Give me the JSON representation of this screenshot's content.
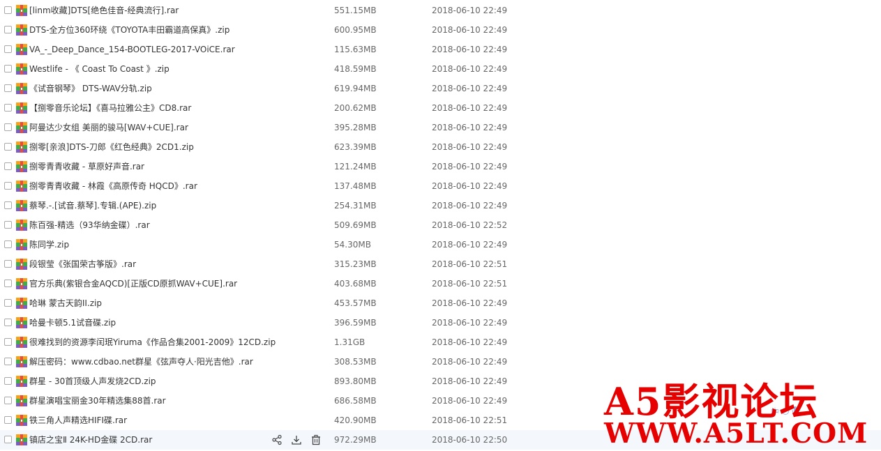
{
  "files": [
    {
      "name": "[linm收藏]DTS[绝色佳音-经典流行].rar",
      "size": "551.15MB",
      "date": "2018-06-10 22:49"
    },
    {
      "name": "DTS-全方位360环绕《TOYOTA丰田霸道高保真》.zip",
      "size": "600.95MB",
      "date": "2018-06-10 22:49"
    },
    {
      "name": "VA_-_Deep_Dance_154-BOOTLEG-2017-VOiCE.rar",
      "size": "115.63MB",
      "date": "2018-06-10 22:49"
    },
    {
      "name": "Westlife - 《 Coast To Coast 》.zip",
      "size": "418.59MB",
      "date": "2018-06-10 22:49"
    },
    {
      "name": "《试音钢琴》 DTS-WAV分轨.zip",
      "size": "619.94MB",
      "date": "2018-06-10 22:49"
    },
    {
      "name": "【捌零音乐论坛】《喜马拉雅公主》CD8.rar",
      "size": "200.62MB",
      "date": "2018-06-10 22:49"
    },
    {
      "name": "阿曼达少女组 美丽的骏马[WAV+CUE].rar",
      "size": "395.28MB",
      "date": "2018-06-10 22:49"
    },
    {
      "name": "捌零[亲浪]DTS-刀郎《红色经典》2CD1.zip",
      "size": "623.39MB",
      "date": "2018-06-10 22:49"
    },
    {
      "name": "捌零青青收藏 - 草原好声音.rar",
      "size": "121.24MB",
      "date": "2018-06-10 22:49"
    },
    {
      "name": "捌零青青收藏 - 林霞《高原传奇 HQCD》.rar",
      "size": "137.48MB",
      "date": "2018-06-10 22:49"
    },
    {
      "name": "蔡琴.-.[试音.蔡琴].专辑.(APE).zip",
      "size": "254.31MB",
      "date": "2018-06-10 22:49"
    },
    {
      "name": "陈百强-精选（93华纳金碟）.rar",
      "size": "509.69MB",
      "date": "2018-06-10 22:52"
    },
    {
      "name": "陈同学.zip",
      "size": "54.30MB",
      "date": "2018-06-10 22:49"
    },
    {
      "name": "段银莹《张国荣古筝版》.rar",
      "size": "315.23MB",
      "date": "2018-06-10 22:51"
    },
    {
      "name": "官方乐典(紫银合金AQCD)[正版CD原抓WAV+CUE].rar",
      "size": "403.68MB",
      "date": "2018-06-10 22:51"
    },
    {
      "name": "哈琳 蒙古天韵II.zip",
      "size": "453.57MB",
      "date": "2018-06-10 22:49"
    },
    {
      "name": "哈曼卡顿5.1试音碟.zip",
      "size": "396.59MB",
      "date": "2018-06-10 22:49"
    },
    {
      "name": "很难找到的资源李闰珉Yiruma《作品合集2001-2009》12CD.zip",
      "size": "1.31GB",
      "date": "2018-06-10 22:49"
    },
    {
      "name": "解压密码：www.cdbao.net群星《弦声夺人·阳光吉他》.rar",
      "size": "308.53MB",
      "date": "2018-06-10 22:49"
    },
    {
      "name": "群星 - 30首顶级人声发烧2CD.zip",
      "size": "893.80MB",
      "date": "2018-06-10 22:49"
    },
    {
      "name": "群星演唱宝丽金30年精选集88首.rar",
      "size": "686.58MB",
      "date": "2018-06-10 22:49"
    },
    {
      "name": "铁三角人声精选HIFI碟.rar",
      "size": "420.90MB",
      "date": "2018-06-10 22:51"
    },
    {
      "name": "镇店之宝Ⅱ 24K-HD金碟 2CD.rar",
      "size": "972.29MB",
      "date": "2018-06-10 22:50"
    }
  ],
  "hover_row_index": 22,
  "row_actions": [
    {
      "name": "share-icon"
    },
    {
      "name": "download-icon"
    },
    {
      "name": "delete-icon"
    }
  ],
  "watermark": {
    "line1": "A5影视论坛",
    "line2": "WWW.A5LT.COM",
    "color": "#e60000"
  },
  "ime_toolbar": {
    "lang": "中"
  },
  "colors": {
    "text": "#333333",
    "meta": "#666666",
    "hover_bg": "#f4f8fd"
  }
}
